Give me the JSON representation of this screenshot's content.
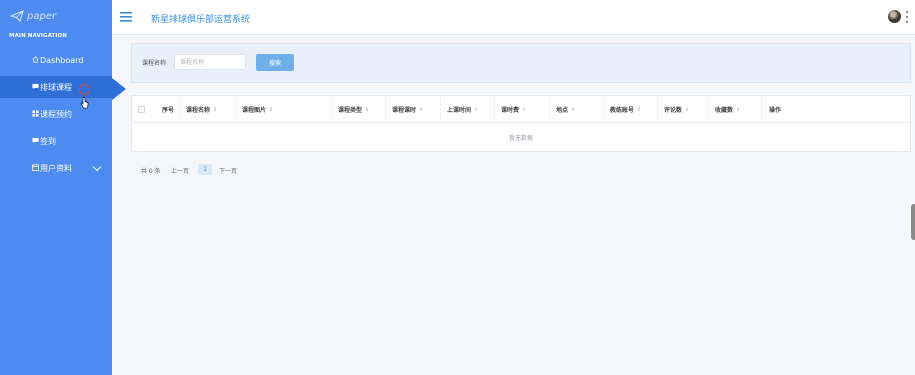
{
  "app": {
    "logo_text": "paper",
    "title": "新星排球俱乐部运营系统"
  },
  "sidebar": {
    "heading": "MAIN NAVIGATION",
    "items": [
      {
        "label": "Dashboard",
        "icon": "home-icon"
      },
      {
        "label": "排球课程",
        "icon": "comment-icon",
        "active": true
      },
      {
        "label": "课程预约",
        "icon": "grid-icon"
      },
      {
        "label": "签到",
        "icon": "comment-icon"
      },
      {
        "label": "用户资料",
        "icon": "calendar-icon",
        "expandable": true
      }
    ]
  },
  "search": {
    "label": "课程名称",
    "placeholder": "课程名称",
    "button": "搜索"
  },
  "table": {
    "columns": [
      "序号",
      "课程名称",
      "课程图片",
      "课程类型",
      "课程课时",
      "上课时间",
      "课时费",
      "地点",
      "教练账号",
      "评论数",
      "收藏数",
      "操作"
    ],
    "sortable": [
      false,
      true,
      true,
      true,
      true,
      true,
      true,
      true,
      true,
      true,
      true,
      false
    ],
    "sort_glyph": "⇕",
    "empty_text": "暂无数据"
  },
  "pagination": {
    "total": "共 0 条",
    "prev": "上一页",
    "current": "1",
    "next": "下一页"
  },
  "colors": {
    "sidebar": "#4d8bf0",
    "sidebar_active": "#2f6fd6",
    "accent": "#3b8fe0",
    "search_button": "#6fb0ea"
  }
}
